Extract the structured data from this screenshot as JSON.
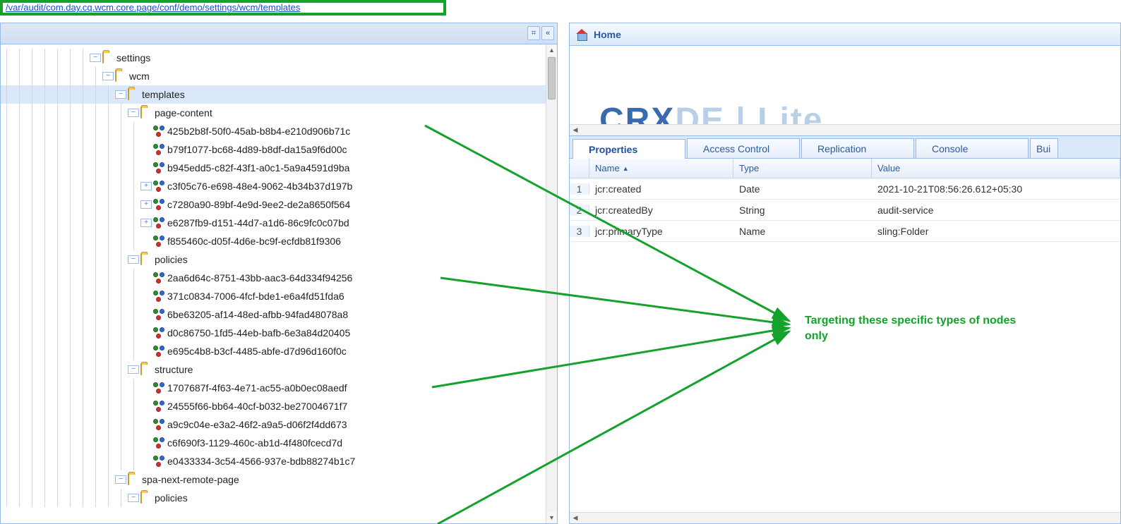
{
  "path": "/var/audit/com.day.cq.wcm.core.page/conf/demo/settings/wcm/templates",
  "home": {
    "label": "Home"
  },
  "logo": {
    "part1": "CRX",
    "part2": "DE",
    "part3": " | Lite"
  },
  "tabs": {
    "properties": "Properties",
    "accessControl": "Access Control",
    "replication": "Replication",
    "console": "Console",
    "build": "Bui"
  },
  "grid": {
    "headers": {
      "name": "Name",
      "type": "Type",
      "value": "Value"
    },
    "rows": [
      {
        "num": "1",
        "name": "jcr:created",
        "type": "Date",
        "value": "2021-10-21T08:56:26.612+05:30"
      },
      {
        "num": "2",
        "name": "jcr:createdBy",
        "type": "String",
        "value": "audit-service"
      },
      {
        "num": "3",
        "name": "jcr:primaryType",
        "type": "Name",
        "value": "sling:Folder"
      }
    ]
  },
  "annotation": {
    "line1": "Targeting these specific types of nodes",
    "line2": "only"
  },
  "tree": [
    {
      "depth": 7,
      "exp": "-",
      "icon": "folder",
      "label": "settings"
    },
    {
      "depth": 8,
      "exp": "-",
      "icon": "folder",
      "label": "wcm"
    },
    {
      "depth": 9,
      "exp": "-",
      "icon": "folder",
      "label": "templates",
      "selected": true
    },
    {
      "depth": 10,
      "exp": "-",
      "icon": "folder",
      "label": "page-content"
    },
    {
      "depth": 11,
      "exp": "",
      "icon": "cluster",
      "label": "425b2b8f-50f0-45ab-b8b4-e210d906b71c",
      "arrow": true
    },
    {
      "depth": 11,
      "exp": "",
      "icon": "cluster",
      "label": "b79f1077-bc68-4d89-b8df-da15a9f6d00c"
    },
    {
      "depth": 11,
      "exp": "",
      "icon": "cluster",
      "label": "b945edd5-c82f-43f1-a0c1-5a9a4591d9ba"
    },
    {
      "depth": 11,
      "exp": "+",
      "icon": "cluster",
      "label": "c3f05c76-e698-48e4-9062-4b34b37d197b"
    },
    {
      "depth": 11,
      "exp": "+",
      "icon": "cluster",
      "label": "c7280a90-89bf-4e9d-9ee2-de2a8650f564"
    },
    {
      "depth": 11,
      "exp": "+",
      "icon": "cluster",
      "label": "e6287fb9-d151-44d7-a1d6-86c9fc0c07bd"
    },
    {
      "depth": 11,
      "exp": "",
      "icon": "cluster",
      "label": "f855460c-d05f-4d6e-bc9f-ecfdb81f9306"
    },
    {
      "depth": 10,
      "exp": "-",
      "icon": "folder",
      "label": "policies"
    },
    {
      "depth": 11,
      "exp": "",
      "icon": "cluster",
      "label": "2aa6d64c-8751-43bb-aac3-64d334f94256",
      "arrow": true
    },
    {
      "depth": 11,
      "exp": "",
      "icon": "cluster",
      "label": "371c0834-7006-4fcf-bde1-e6a4fd51fda6"
    },
    {
      "depth": 11,
      "exp": "",
      "icon": "cluster",
      "label": "6be63205-af14-48ed-afbb-94fad48078a8"
    },
    {
      "depth": 11,
      "exp": "",
      "icon": "cluster",
      "label": "d0c86750-1fd5-44eb-bafb-6e3a84d20405"
    },
    {
      "depth": 11,
      "exp": "",
      "icon": "cluster",
      "label": "e695c4b8-b3cf-4485-abfe-d7d96d160f0c"
    },
    {
      "depth": 10,
      "exp": "-",
      "icon": "folder",
      "label": "structure"
    },
    {
      "depth": 11,
      "exp": "",
      "icon": "cluster",
      "label": "1707687f-4f63-4e71-ac55-a0b0ec08aedf",
      "arrow": true
    },
    {
      "depth": 11,
      "exp": "",
      "icon": "cluster",
      "label": "24555f66-bb64-40cf-b032-be27004671f7"
    },
    {
      "depth": 11,
      "exp": "",
      "icon": "cluster",
      "label": "a9c9c04e-e3a2-46f2-a9a5-d06f2f4dd673"
    },
    {
      "depth": 11,
      "exp": "",
      "icon": "cluster",
      "label": "c6f690f3-1129-460c-ab1d-4f480fcecd7d"
    },
    {
      "depth": 11,
      "exp": "",
      "icon": "cluster",
      "label": "e0433334-3c54-4566-937e-bdb88274b1c7"
    },
    {
      "depth": 9,
      "exp": "-",
      "icon": "folder",
      "label": "spa-next-remote-page"
    },
    {
      "depth": 10,
      "exp": "-",
      "icon": "folder",
      "label": "policies"
    }
  ]
}
